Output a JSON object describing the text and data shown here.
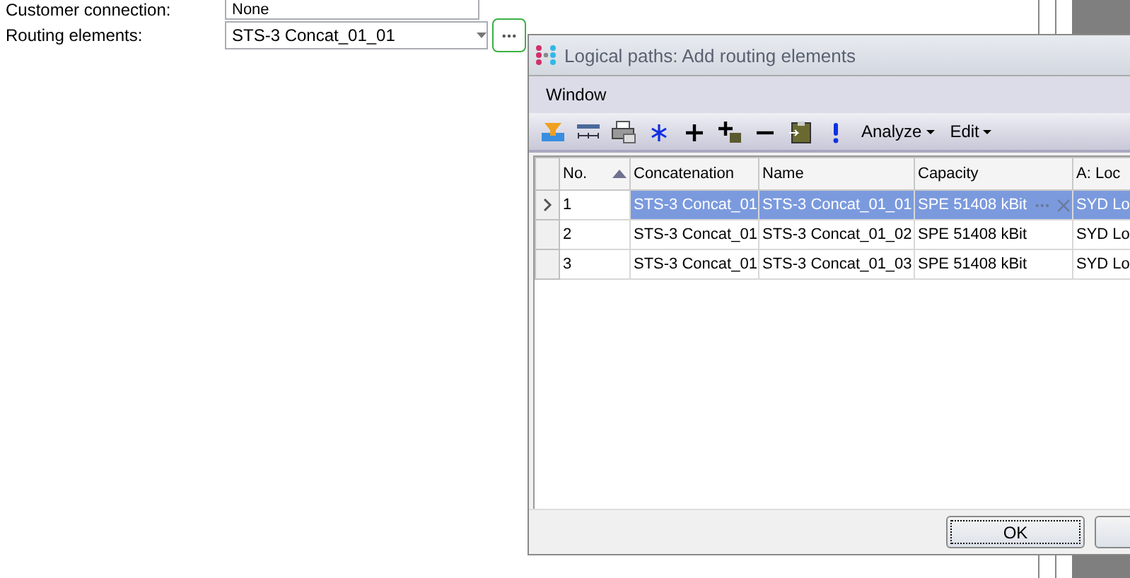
{
  "form": [
    {
      "label": "Customer connection:",
      "value": "None"
    },
    {
      "label": "Routing elements:",
      "value": "STS-3 Concat_01_01"
    }
  ],
  "dialog": {
    "title": "Logical paths: Add routing elements",
    "menu": [
      "Window"
    ],
    "toolbar": [
      {
        "kind": "icon"
      },
      {
        "kind": "icon"
      },
      {
        "kind": "icon"
      },
      {
        "kind": "icon"
      },
      {
        "kind": "icon"
      },
      {
        "kind": "icon"
      },
      {
        "kind": "icon"
      },
      {
        "kind": "icon"
      },
      {
        "kind": "icon"
      },
      {
        "kind": "menu",
        "label": "Analyze"
      },
      {
        "kind": "menu",
        "label": "Edit"
      }
    ],
    "table": {
      "columns": [
        {
          "label": "No.",
          "sorted": true
        },
        {
          "label": "Concatenation",
          "sorted": false
        },
        {
          "label": "Name",
          "sorted": false
        },
        {
          "label": "Capacity",
          "sorted": false
        },
        {
          "label": "A: Loc",
          "sorted": false
        }
      ],
      "rows": [
        {
          "selected": true,
          "cells": [
            "1",
            "STS-3 Concat_01",
            "STS-3 Concat_01_01",
            "SPE 51408 kBit",
            "SYD Lo"
          ]
        },
        {
          "selected": false,
          "cells": [
            "2",
            "STS-3 Concat_01",
            "STS-3 Concat_01_02",
            "SPE 51408 kBit",
            "SYD Lo"
          ]
        },
        {
          "selected": false,
          "cells": [
            "3",
            "STS-3 Concat_01",
            "STS-3 Concat_01_03",
            "SPE 51408 kBit",
            "SYD Lo"
          ]
        }
      ]
    },
    "buttons": [
      "OK"
    ]
  }
}
